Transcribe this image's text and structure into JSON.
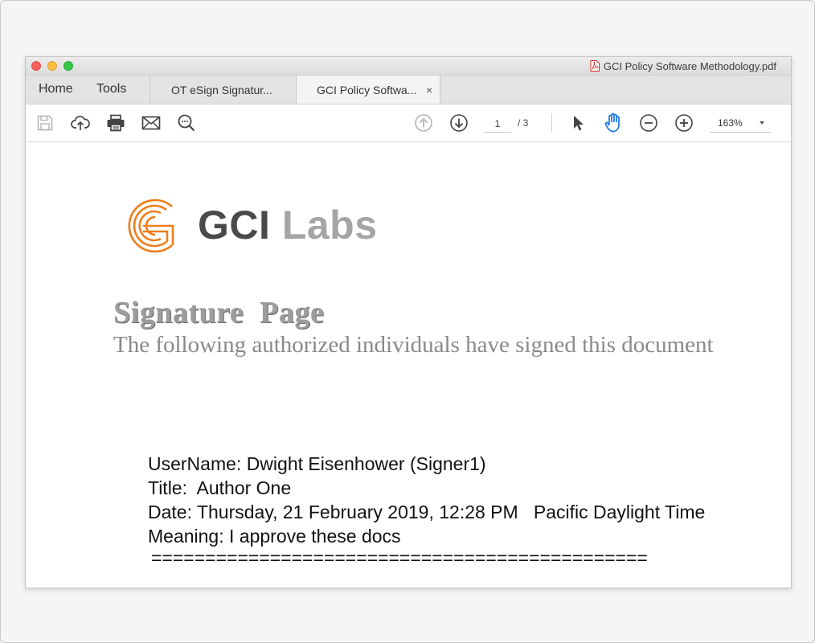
{
  "window": {
    "title": "GCI Policy Software Methodology.pdf"
  },
  "nav": {
    "home": "Home",
    "tools": "Tools"
  },
  "tabs": [
    {
      "label": "OT eSign Signatur...",
      "active": false
    },
    {
      "label": "GCI Policy Softwa...",
      "active": true,
      "close": "×"
    }
  ],
  "toolbar": {
    "icons": [
      "save-icon",
      "upload-cloud-icon",
      "print-icon",
      "email-icon",
      "search-icon",
      "prev-page-icon",
      "next-page-icon",
      "select-cursor-icon",
      "hand-tool-icon",
      "zoom-out-icon",
      "zoom-in-icon"
    ],
    "page_current": "1",
    "page_sep": "/ 3",
    "zoom": "163%"
  },
  "colors": {
    "hand_active": "#1473e6",
    "logo_orange": "#ef7d1b",
    "logo_dark": "#4a4a4a",
    "logo_light": "#a5a5a5"
  },
  "document": {
    "logo_gci": "GCI",
    "logo_labs": "Labs",
    "heading": "Signature  Page",
    "subheading": "The following authorized individuals have signed this document",
    "username_line": "UserName: Dwight Eisenhower (Signer1)",
    "title_line": "Title:  Author One",
    "date_line": "Date: Thursday, 21 February 2019, 12:28 PM   Pacific Daylight Time",
    "meaning_line": "Meaning: I approve these docs",
    "separator": "=============================================="
  }
}
